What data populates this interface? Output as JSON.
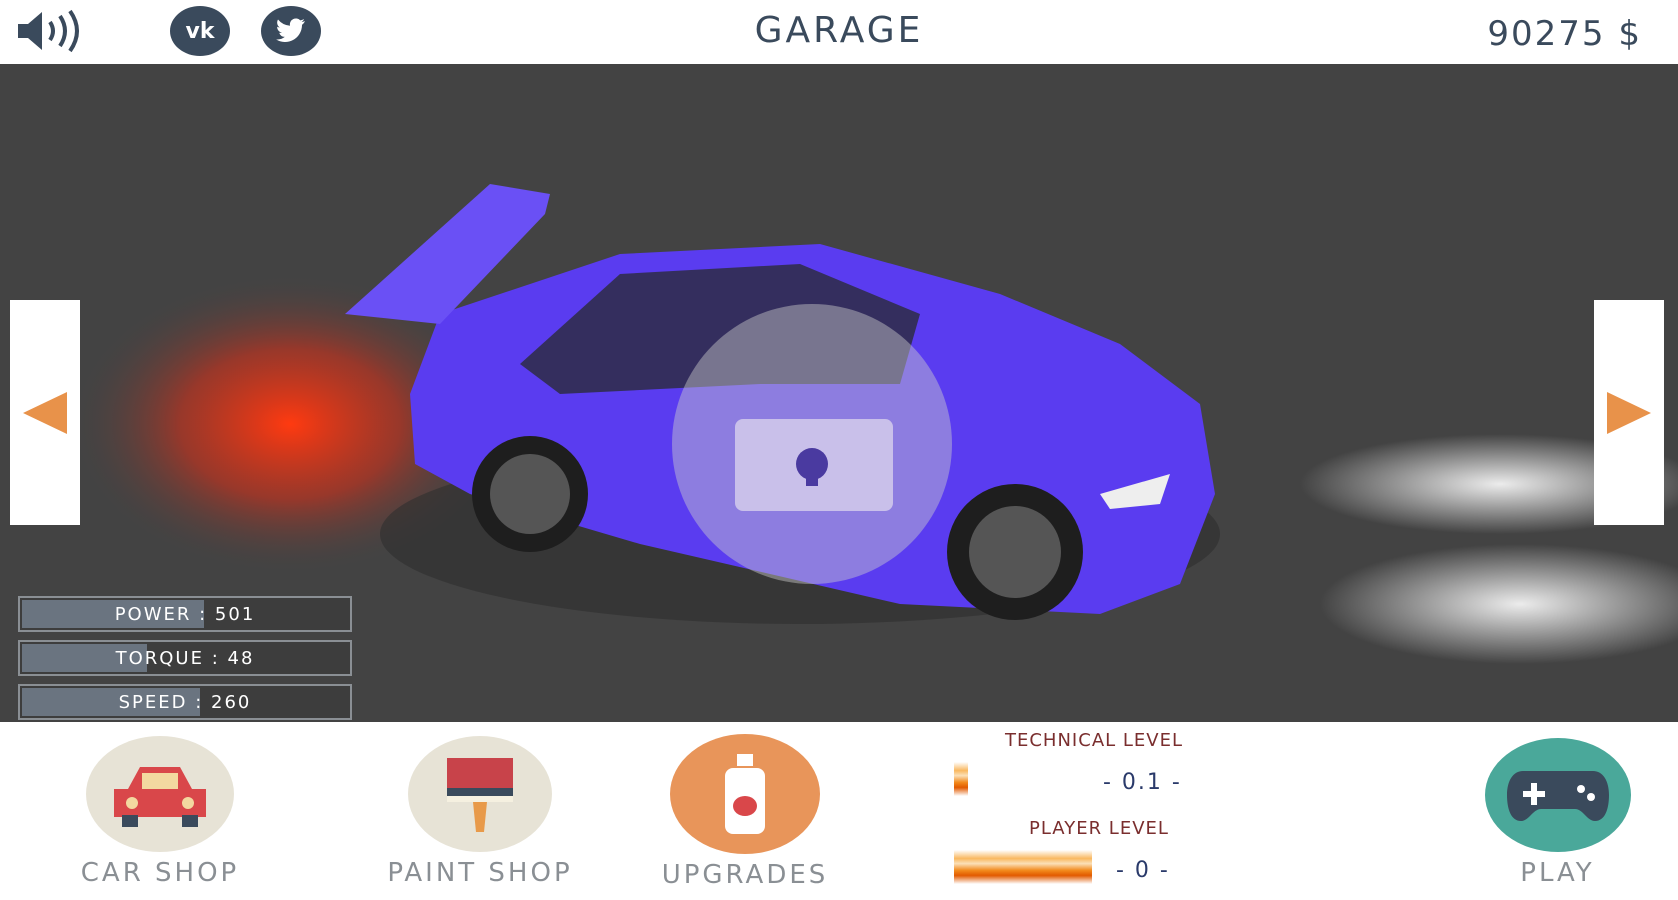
{
  "header": {
    "title": "GARAGE",
    "money": "90275 $",
    "icons": [
      "speaker-icon",
      "vk-icon",
      "twitter-icon"
    ],
    "vk_text": "vk"
  },
  "stats": [
    {
      "label": "POWER : 501",
      "fill": 0.55
    },
    {
      "label": "TORQUE : 48",
      "fill": 0.38
    },
    {
      "label": "SPEED : 260",
      "fill": 0.54
    }
  ],
  "car": {
    "color": "#5a3cf0",
    "locked": true
  },
  "nav": {
    "prev_icon": "triangle-left-icon",
    "next_icon": "triangle-right-icon",
    "arrow_color": "#e8924a"
  },
  "bottom": {
    "car_shop": "CAR SHOP",
    "paint_shop": "PAINT SHOP",
    "upgrades": "UPGRADES",
    "play": "PLAY",
    "technical_level_label": "TECHNICAL LEVEL",
    "technical_level_value": "- 0.1 -",
    "technical_level_fill": 0.1,
    "player_level_label": "PLAYER LEVEL",
    "player_level_value": "- 0 -",
    "player_level_fill": 1.0
  }
}
